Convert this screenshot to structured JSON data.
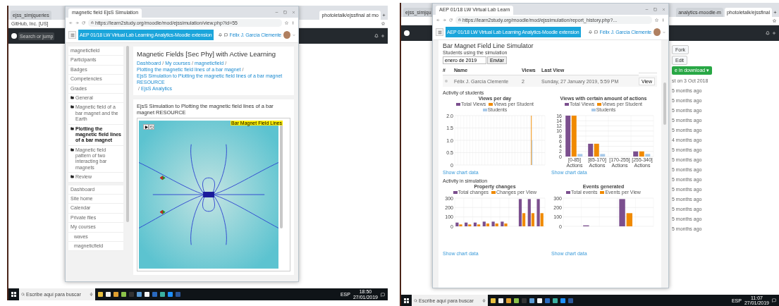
{
  "screens": [
    {
      "back_browser": {
        "left_tabs": [
          {
            "label": "ejss_simjqueries",
            "selected": false
          }
        ],
        "right_tabs": [
          {
            "label": "photoletalk/ejssfinal at mo",
            "selected": true
          }
        ],
        "address": "GitHub, Inc. [US]",
        "search_placeholder": "Search or jump"
      },
      "window": {
        "kind": "course",
        "tab": {
          "label": "magnetic field EjsS Simulation",
          "selected": true
        },
        "url": "https://learn2study.org/moodle/mod/ejssimulation/view.php?id=55",
        "banner": "AEP 01/18 LW Virtual Lab Learning Analytics-Moodle extension",
        "user": "Félix J. García Clemente",
        "sidebar": [
          [
            {
              "label": "magneticfield",
              "kind": "link",
              "selected": false
            },
            {
              "label": "Participants",
              "kind": "link",
              "selected": false
            },
            {
              "label": "Badges",
              "kind": "link",
              "selected": false
            },
            {
              "label": "Competencies",
              "kind": "link",
              "selected": false
            },
            {
              "label": "Grades",
              "kind": "link",
              "selected": false
            },
            {
              "label": "General",
              "kind": "section",
              "selected": false
            },
            {
              "label": "Magnetic field of a bar magnet and the Earth",
              "kind": "section",
              "selected": false
            },
            {
              "label": "Plotting the magnetic field lines of a bar magnet",
              "kind": "section",
              "selected": true
            },
            {
              "label": "Magnetic field pattern of two interacting bar magnets",
              "kind": "section",
              "selected": false
            },
            {
              "label": "Review",
              "kind": "section",
              "selected": false
            }
          ],
          [
            {
              "label": "Dashboard",
              "kind": "link",
              "selected": false
            },
            {
              "label": "Site home",
              "kind": "link",
              "selected": false
            },
            {
              "label": "Calendar",
              "kind": "link",
              "selected": false
            },
            {
              "label": "Private files",
              "kind": "link",
              "selected": false
            },
            {
              "label": "My courses",
              "kind": "link",
              "selected": false,
              "children": [
                {
                  "label": "waves",
                  "kind": "link",
                  "selected": false
                },
                {
                  "label": "magneticfield",
                  "kind": "link",
                  "selected": false
                }
              ]
            }
          ]
        ],
        "title": "Magnetic Fields [Sec Phy] with Active Learning",
        "breadcrumb_separator": "/",
        "breadcrumb": [
          "Dashboard",
          "My courses",
          "magneticfield",
          "Plotting the magnetic field lines of a bar magnet",
          "EjsS Simulation to Plotting the magnetic field lines of a bar magnet RESOURCE",
          "EjsS Analytics"
        ],
        "section_title": "EjsS Simulation to Plotting the magnetic field lines of a bar magnet RESOURCE",
        "simulation": {
          "label": "Bar Magnet Field Lines"
        }
      },
      "taskbar": {
        "search_placeholder": "Escribe aquí para buscar",
        "language": "ESP",
        "time": "18:50",
        "date": "27/01/2019"
      }
    },
    {
      "back_browser": {
        "left_tabs": [
          {
            "label": "ejss_simjqu",
            "selected": false
          }
        ],
        "right_tabs": [
          {
            "label": "analytics-moodle-m",
            "selected": false
          },
          {
            "label": "photoletalk/ejssfinal",
            "selected": true
          }
        ]
      },
      "window": {
        "kind": "report",
        "tab": {
          "label": "AEP 01/18 LW Virtual Lab Learn",
          "selected": true
        },
        "url": "https://learn2study.org/moodle/mod/ejssimulation/report_history.php?...",
        "banner": "AEP 01/18 LW Virtual Lab Learning Analytics-Moodle extension",
        "user": "Félix J. García Clemente",
        "title": "Bar Magnet Field Line Simulator",
        "subtitle": "Students using the simulation",
        "date_field": "enero de 2019",
        "submit": "Enviar",
        "table": {
          "columns": [
            "#",
            "Name",
            "Views",
            "Last View"
          ],
          "rows": [
            {
              "cells": [
                "",
                "Félix J. García Clemente",
                "2",
                "Sunday, 27 January 2019, 5:59 PM"
              ],
              "action": "View"
            }
          ]
        },
        "sections": [
          {
            "heading": "Activity of students",
            "charts": [
              {
                "link": "Show chart data",
                "chart_data": {
                  "type": "bar",
                  "title": "Views per day",
                  "legend": "top",
                  "grid": true,
                  "ylim": [
                    0,
                    2
                  ],
                  "yticks": [
                    0,
                    0.5,
                    {
                      "value": 1,
                      "label": "1.0"
                    },
                    1.5,
                    {
                      "value": 2,
                      "label": "2.0"
                    }
                  ],
                  "series": [
                    {
                      "name": "Total Views",
                      "color": "#7b4f8e",
                      "values": [
                        0,
                        0,
                        0,
                        0,
                        0,
                        0,
                        0,
                        0,
                        0,
                        0,
                        0,
                        0,
                        0,
                        0,
                        0,
                        0,
                        0,
                        0,
                        0,
                        0,
                        0,
                        0,
                        0,
                        0,
                        0,
                        0,
                        0,
                        0,
                        0,
                        0
                      ]
                    },
                    {
                      "name": "Views per Student",
                      "color": "#f08a00",
                      "values": [
                        0,
                        0,
                        0,
                        0,
                        0,
                        0,
                        0,
                        0,
                        0,
                        0,
                        0,
                        0,
                        0,
                        0,
                        0,
                        0,
                        0,
                        0,
                        0,
                        0,
                        0,
                        0,
                        0,
                        0,
                        0,
                        2,
                        0,
                        0,
                        0,
                        0
                      ]
                    },
                    {
                      "name": "Students",
                      "color": "#a8c9e8",
                      "values": [
                        0,
                        0,
                        0,
                        0,
                        0,
                        0,
                        0,
                        0,
                        0,
                        0,
                        0,
                        0,
                        0,
                        0,
                        0,
                        0,
                        0,
                        0,
                        0,
                        0,
                        0,
                        0,
                        0,
                        0,
                        0,
                        1,
                        0,
                        0,
                        0,
                        0
                      ]
                    }
                  ]
                }
              },
              {
                "link": "Show chart data",
                "chart_data": {
                  "type": "bar",
                  "title": "Views with certain amount of actions",
                  "legend": "top",
                  "grid": true,
                  "categories": [
                    "[0-85] Actions",
                    "[85-170] Actions",
                    "[170-255] Actions",
                    "[255-340] Actions"
                  ],
                  "ylim": [
                    0,
                    16
                  ],
                  "yticks": [
                    0,
                    2,
                    4,
                    6,
                    8,
                    10,
                    12,
                    14,
                    16
                  ],
                  "series": [
                    {
                      "name": "Total Views",
                      "color": "#7b4f8e",
                      "values": [
                        16,
                        5,
                        0,
                        2
                      ]
                    },
                    {
                      "name": "Views per Student",
                      "color": "#f08a00",
                      "values": [
                        16,
                        5,
                        0,
                        2
                      ]
                    },
                    {
                      "name": "Students",
                      "color": "#a8c9e8",
                      "values": [
                        1,
                        1,
                        0,
                        1
                      ]
                    }
                  ]
                }
              }
            ]
          },
          {
            "heading": "Activity in simulation",
            "charts": [
              {
                "link": "Show chart data",
                "chart_data": {
                  "type": "bar",
                  "title": "Property changes",
                  "legend": "top",
                  "grid": true,
                  "ylim": [
                    0,
                    300
                  ],
                  "yticks": [
                    0,
                    100,
                    200,
                    300
                  ],
                  "series": [
                    {
                      "name": "Total changes",
                      "color": "#7b4f8e",
                      "values": [
                        40,
                        40,
                        40,
                        50,
                        50,
                        50,
                        0,
                        290,
                        290,
                        290
                      ]
                    },
                    {
                      "name": "Changes per View",
                      "color": "#f08a00",
                      "values": [
                        20,
                        20,
                        20,
                        30,
                        30,
                        30,
                        0,
                        140,
                        140,
                        140
                      ]
                    }
                  ]
                }
              },
              {
                "link": "Show chart data",
                "chart_data": {
                  "type": "bar",
                  "title": "Events generated",
                  "legend": "top",
                  "grid": true,
                  "ylim": [
                    0,
                    300
                  ],
                  "yticks": [
                    0,
                    100,
                    200,
                    300
                  ],
                  "series": [
                    {
                      "name": "Total events",
                      "color": "#7b4f8e",
                      "values": [
                        0,
                        10,
                        0,
                        290,
                        0
                      ]
                    },
                    {
                      "name": "Events per View",
                      "color": "#f08a00",
                      "values": [
                        0,
                        0,
                        0,
                        140,
                        0
                      ]
                    }
                  ]
                }
              }
            ]
          }
        ]
      },
      "page_items": [
        {
          "kind": "button",
          "text": "Fork"
        },
        {
          "kind": "button",
          "text": "Edit"
        },
        {
          "kind": "green",
          "text": "e in download ▾"
        },
        {
          "kind": "text",
          "text": "st on 3 Oct 2018"
        },
        {
          "kind": "row",
          "text": "5 months ago"
        },
        {
          "kind": "row",
          "text": "5 months ago"
        },
        {
          "kind": "row",
          "text": "5 months ago"
        },
        {
          "kind": "row",
          "text": "5 months ago"
        },
        {
          "kind": "row",
          "text": "5 months ago"
        },
        {
          "kind": "row",
          "text": "4 months ago"
        },
        {
          "kind": "row",
          "text": "5 months ago"
        },
        {
          "kind": "row",
          "text": "5 months ago"
        },
        {
          "kind": "row",
          "text": "5 months ago"
        },
        {
          "kind": "row",
          "text": "5 months ago"
        },
        {
          "kind": "row",
          "text": "5 months ago"
        },
        {
          "kind": "row",
          "text": "5 months ago"
        },
        {
          "kind": "row",
          "text": "5 months ago"
        },
        {
          "kind": "row",
          "text": "5 months ago"
        },
        {
          "kind": "row",
          "text": "5 months ago"
        }
      ],
      "taskbar": {
        "search_placeholder": "Escribe aquí para buscar",
        "language": "ESP",
        "time": "11:07",
        "date": "27/01/2019"
      }
    }
  ]
}
